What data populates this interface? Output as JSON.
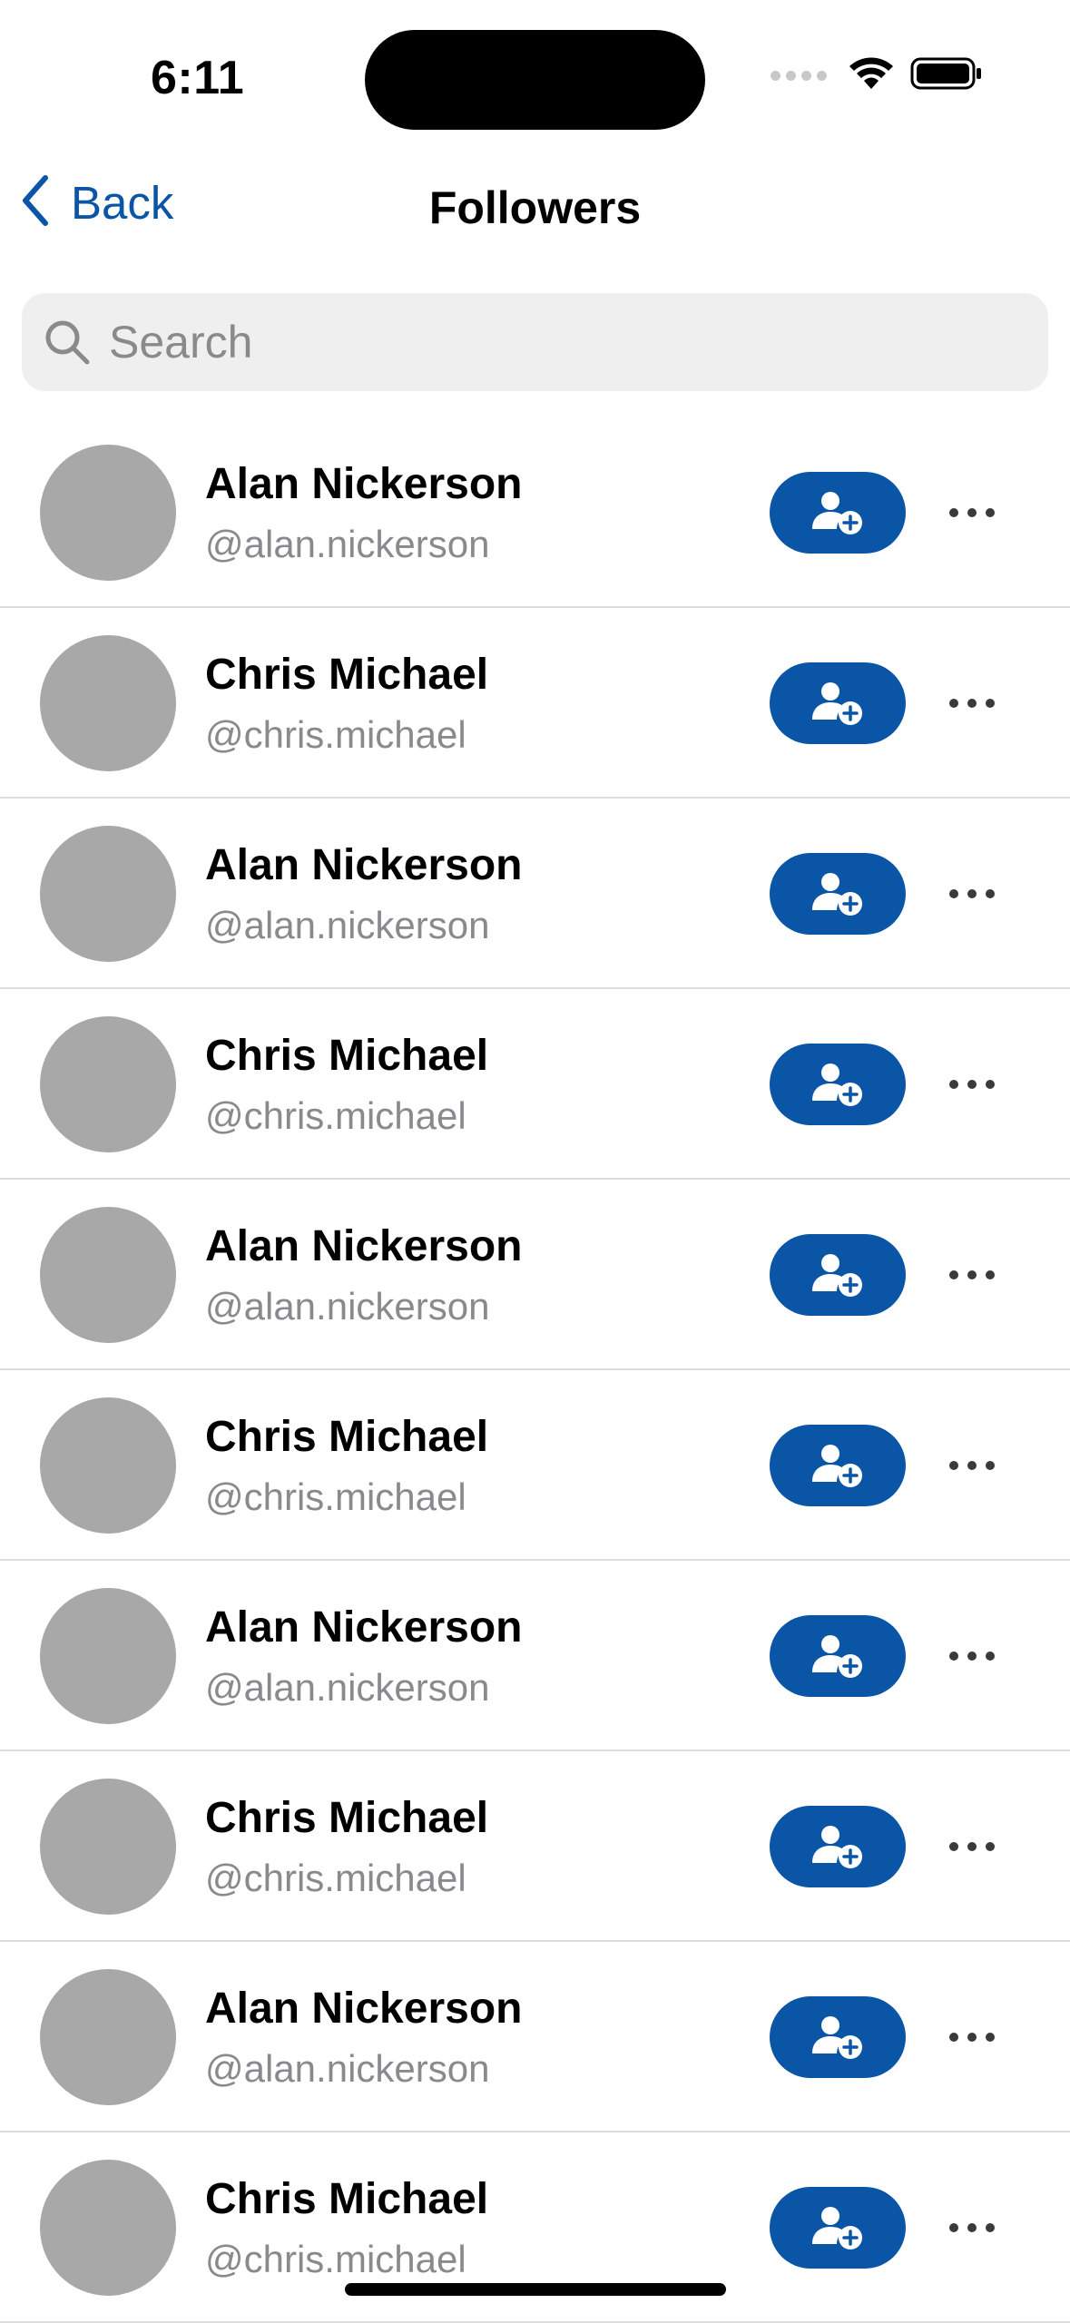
{
  "status_bar": {
    "time": "6:11"
  },
  "nav": {
    "back_label": "Back",
    "title": "Followers"
  },
  "search": {
    "placeholder": "Search",
    "value": ""
  },
  "followers": [
    {
      "name": "Alan Nickerson",
      "handle": "@alan.nickerson"
    },
    {
      "name": "Chris Michael",
      "handle": "@chris.michael"
    },
    {
      "name": "Alan Nickerson",
      "handle": "@alan.nickerson"
    },
    {
      "name": "Chris Michael",
      "handle": "@chris.michael"
    },
    {
      "name": "Alan Nickerson",
      "handle": "@alan.nickerson"
    },
    {
      "name": "Chris Michael",
      "handle": "@chris.michael"
    },
    {
      "name": "Alan Nickerson",
      "handle": "@alan.nickerson"
    },
    {
      "name": "Chris Michael",
      "handle": "@chris.michael"
    },
    {
      "name": "Alan Nickerson",
      "handle": "@alan.nickerson"
    },
    {
      "name": "Chris Michael",
      "handle": "@chris.michael"
    }
  ],
  "icons": {
    "back": "chevron-left-icon",
    "search": "search-icon",
    "follow": "person-add-icon",
    "more": "ellipsis-icon"
  },
  "colors": {
    "accent": "#0b55a6",
    "avatar_placeholder": "#a8a8a8",
    "secondary_text": "#8a8a8e",
    "search_bg": "#efefef",
    "divider": "#dcdcdc"
  }
}
